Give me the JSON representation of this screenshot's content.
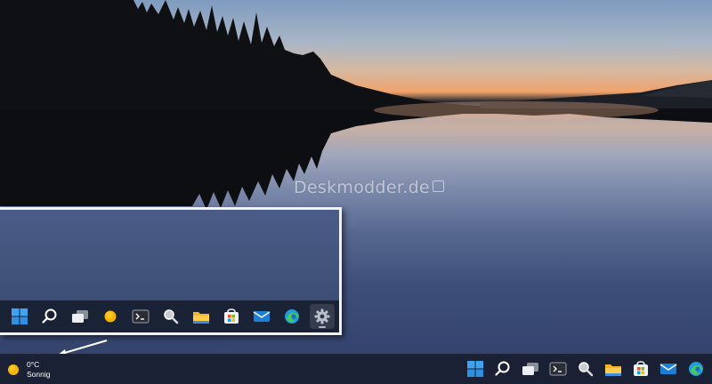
{
  "watermark": "Deskmodder.de",
  "weather": {
    "temperature": "0°C",
    "condition": "Sonnig",
    "icon": "sun-icon"
  },
  "inset_taskbar": {
    "items": [
      {
        "name": "start",
        "icon": "windows-logo-icon"
      },
      {
        "name": "search",
        "icon": "search-icon"
      },
      {
        "name": "task-view",
        "icon": "task-view-icon"
      },
      {
        "name": "weather-widget",
        "icon": "sun-icon"
      },
      {
        "name": "terminal",
        "icon": "terminal-icon"
      },
      {
        "name": "magnifier",
        "icon": "magnifier-icon"
      },
      {
        "name": "file-explorer",
        "icon": "folder-icon"
      },
      {
        "name": "microsoft-store",
        "icon": "store-icon"
      },
      {
        "name": "mail",
        "icon": "mail-icon"
      },
      {
        "name": "edge",
        "icon": "edge-icon"
      },
      {
        "name": "settings",
        "icon": "gear-icon",
        "active": true
      }
    ]
  },
  "taskbar": {
    "items": [
      {
        "name": "start",
        "icon": "windows-logo-icon"
      },
      {
        "name": "search",
        "icon": "search-icon"
      },
      {
        "name": "task-view",
        "icon": "task-view-icon"
      },
      {
        "name": "terminal",
        "icon": "terminal-icon"
      },
      {
        "name": "magnifier",
        "icon": "magnifier-icon"
      },
      {
        "name": "file-explorer",
        "icon": "folder-icon"
      },
      {
        "name": "microsoft-store",
        "icon": "store-icon"
      },
      {
        "name": "mail",
        "icon": "mail-icon"
      },
      {
        "name": "edge",
        "icon": "edge-icon"
      }
    ]
  },
  "colors": {
    "accent": "#3a8ee6",
    "taskbar": "#1a2134",
    "sun": "#f5b400"
  }
}
